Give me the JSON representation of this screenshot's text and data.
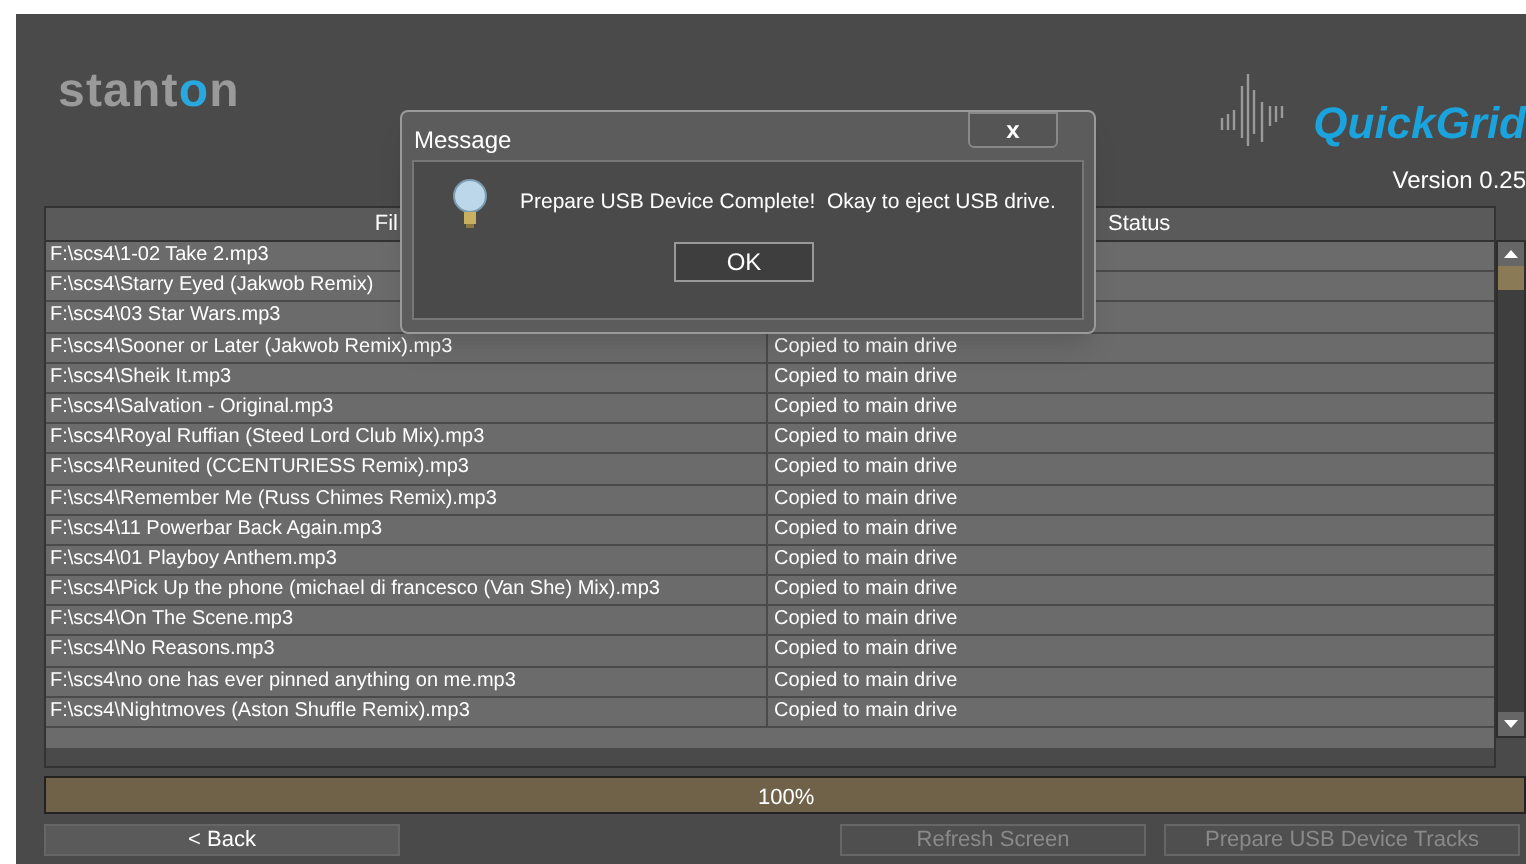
{
  "header": {
    "logo": "stanton",
    "product": "QuickGrid",
    "version": "Version 0.25"
  },
  "table": {
    "columns": [
      "Fil",
      "Status"
    ],
    "rows": [
      {
        "file": "F:\\scs4\\1-02 Take 2.mp3"
      },
      {
        "file": "F:\\scs4\\Starry Eyed (Jakwob Remix)"
      },
      {
        "file": "F:\\scs4\\03 Star Wars.mp3"
      },
      {
        "file": "F:\\scs4\\Sooner or Later (Jakwob Remix).mp3",
        "status": "Copied to main drive"
      },
      {
        "file": "F:\\scs4\\Sheik It.mp3",
        "status": "Copied to main drive"
      },
      {
        "file": "F:\\scs4\\Salvation - Original.mp3",
        "status": "Copied to main drive"
      },
      {
        "file": "F:\\scs4\\Royal Ruffian (Steed Lord Club Mix).mp3",
        "status": "Copied to main drive"
      },
      {
        "file": "F:\\scs4\\Reunited (CCENTURIESS Remix).mp3",
        "status": "Copied to main drive"
      },
      {
        "file": "F:\\scs4\\Remember Me (Russ Chimes Remix).mp3",
        "status": "Copied to main drive"
      },
      {
        "file": "F:\\scs4\\11 Powerbar Back Again.mp3",
        "status": "Copied to main drive"
      },
      {
        "file": "F:\\scs4\\01 Playboy Anthem.mp3",
        "status": "Copied to main drive"
      },
      {
        "file": "F:\\scs4\\Pick Up the phone (michael di francesco (Van She) Mix).mp3",
        "status": "Copied to main drive"
      },
      {
        "file": "F:\\scs4\\On The Scene.mp3",
        "status": "Copied to main drive"
      },
      {
        "file": "F:\\scs4\\No Reasons.mp3",
        "status": "Copied to main drive"
      },
      {
        "file": "F:\\scs4\\no one has ever pinned anything on me.mp3",
        "status": "Copied to main drive"
      },
      {
        "file": "F:\\scs4\\Nightmoves (Aston Shuffle Remix).mp3",
        "status": "Copied to main drive"
      }
    ]
  },
  "progress": {
    "level": 1,
    "reading": "100%"
  },
  "buttons": [
    {
      "label": "< Back",
      "disabled": false
    },
    {
      "label": "Refresh Screen",
      "disabled": true
    },
    {
      "label": "Prepare USB Device Tracks",
      "disabled": true
    }
  ],
  "dialog": {
    "title": "Message",
    "close": "x",
    "message": "Prepare USB Device Complete!  Okay to eject USB drive.",
    "button": "OK"
  }
}
